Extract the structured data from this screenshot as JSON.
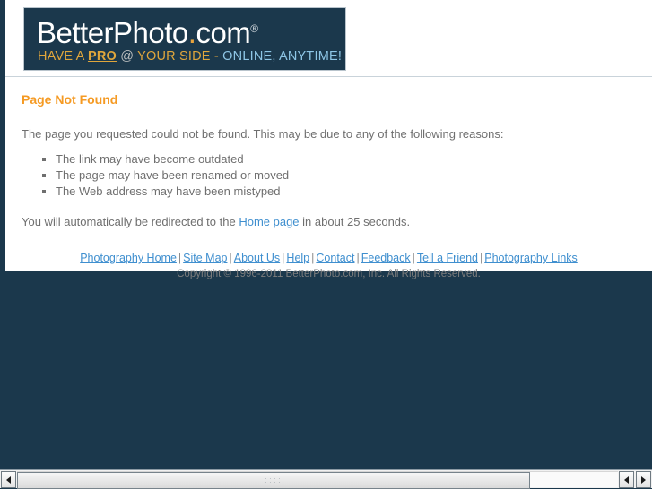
{
  "header": {
    "logo": {
      "wordmark_part1": "BetterPhoto",
      "wordmark_dot": ".",
      "wordmark_part2": "com",
      "registered_mark": "®",
      "tagline_gold_1": "HAVE A ",
      "tagline_pro": "PRO",
      "tagline_at": " @ ",
      "tagline_gold_2": "YOUR SIDE - ",
      "tagline_blue": "ONLINE, ANYTIME!"
    }
  },
  "main": {
    "page_title": "Page Not Found",
    "intro_text": "The page you requested could not be found. This may be due to any of the following reasons:",
    "reasons": [
      "The link may have become outdated",
      "The page may have been renamed or moved",
      "The Web address may have been mistyped"
    ],
    "redirect": {
      "prefix": "You will automatically be redirected to the ",
      "link_label": "Home page",
      "suffix": " in about 25 seconds.",
      "seconds": "25"
    }
  },
  "footer": {
    "links": [
      "Photography Home",
      "Site Map",
      "About Us",
      "Help",
      "Contact",
      "Feedback",
      "Tell a Friend",
      "Photography Links"
    ],
    "separator": "|",
    "copyright": "Copyright © 1996-2011 BetterPhoto.com, Inc. All Rights Reserved."
  },
  "scrollbar": {
    "left_arrow": "◀",
    "right_arrow_1": "◀",
    "right_arrow_2": "▶"
  },
  "colors": {
    "brand_navy": "#1b384c",
    "accent_orange": "#f59a23",
    "tagline_gold": "#e0a63c",
    "tagline_blue": "#8ec6e6",
    "link_blue": "#3f8fcf",
    "body_gray": "#6f6f6f"
  }
}
